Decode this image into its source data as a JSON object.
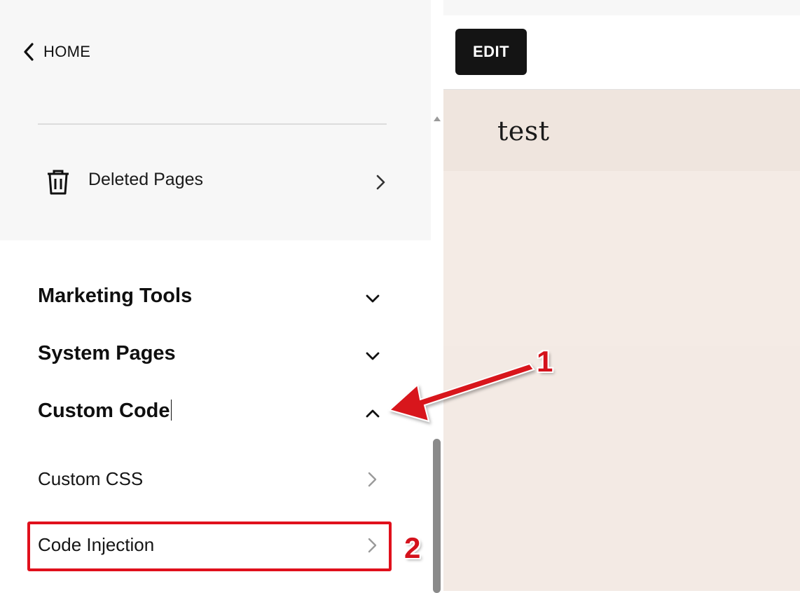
{
  "sidebar": {
    "back_label": "HOME",
    "deleted_pages_label": "Deleted Pages",
    "sections": {
      "marketing_tools": "Marketing Tools",
      "system_pages": "System Pages",
      "custom_code": "Custom Code"
    },
    "custom_code_items": {
      "custom_css": "Custom CSS",
      "code_injection": "Code Injection"
    }
  },
  "preview": {
    "edit_label": "EDIT",
    "site_title": "test"
  },
  "annotations": {
    "step1": "1",
    "step2": "2",
    "accent_color": "#e0101c"
  }
}
